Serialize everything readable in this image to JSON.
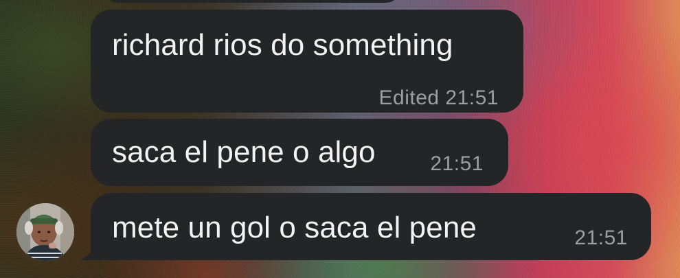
{
  "chat": {
    "messages": [
      {
        "text": "richard rios do something",
        "meta": "Edited 21:51"
      },
      {
        "text": "saca el pene o algo",
        "meta": "21:51"
      },
      {
        "text": "mete un gol o saca el pene",
        "meta": "21:51"
      }
    ]
  },
  "avatar": {
    "icon": "user-avatar"
  },
  "colors": {
    "bubble": "#242526",
    "text": "#f3f3f3",
    "meta": "#9c9ea3"
  }
}
